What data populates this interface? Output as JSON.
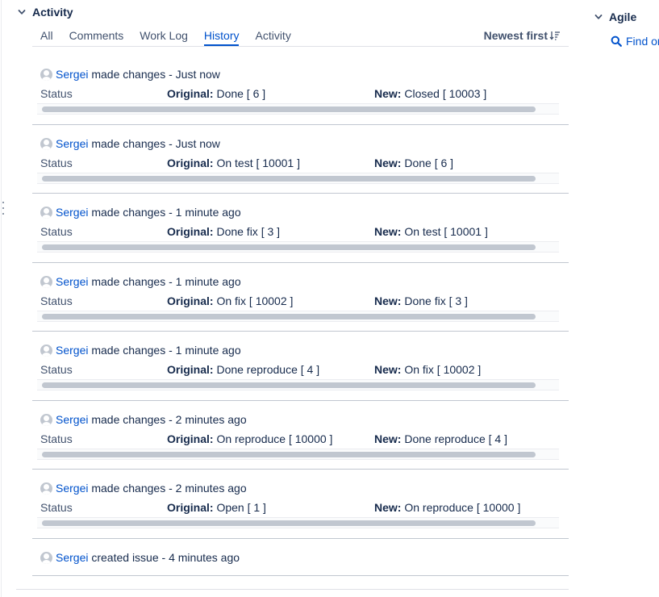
{
  "activity": {
    "title": "Activity",
    "tabs": [
      {
        "label": "All"
      },
      {
        "label": "Comments"
      },
      {
        "label": "Work Log"
      },
      {
        "label": "History"
      },
      {
        "label": "Activity"
      }
    ],
    "active_tab": "History",
    "sort_label": "Newest first",
    "original_label": "Original:",
    "new_label": "New:",
    "entries": [
      {
        "user": "Sergei",
        "action": "made changes",
        "time": "Just now",
        "field": "Status",
        "original": "Done [ 6 ]",
        "new": "Closed [ 10003 ]"
      },
      {
        "user": "Sergei",
        "action": "made changes",
        "time": "Just now",
        "field": "Status",
        "original": "On test [ 10001 ]",
        "new": "Done [ 6 ]"
      },
      {
        "user": "Sergei",
        "action": "made changes",
        "time": "1 minute ago",
        "field": "Status",
        "original": "Done fix [ 3 ]",
        "new": "On test [ 10001 ]"
      },
      {
        "user": "Sergei",
        "action": "made changes",
        "time": "1 minute ago",
        "field": "Status",
        "original": "On fix [ 10002 ]",
        "new": "Done fix [ 3 ]"
      },
      {
        "user": "Sergei",
        "action": "made changes",
        "time": "1 minute ago",
        "field": "Status",
        "original": "Done reproduce [ 4 ]",
        "new": "On fix [ 10002 ]"
      },
      {
        "user": "Sergei",
        "action": "made changes",
        "time": "2 minutes ago",
        "field": "Status",
        "original": "On reproduce [ 10000 ]",
        "new": "Done reproduce [ 4 ]"
      },
      {
        "user": "Sergei",
        "action": "made changes",
        "time": "2 minutes ago",
        "field": "Status",
        "original": "Open [ 1 ]",
        "new": "On reproduce [ 10000 ]"
      },
      {
        "user": "Sergei",
        "action": "created issue",
        "time": "4 minutes ago"
      }
    ]
  },
  "agile": {
    "title": "Agile",
    "find_link": "Find on"
  },
  "colors": {
    "link": "#0052cc",
    "text": "#172b4d",
    "muted": "#42526e",
    "separator": "#c1c7d0"
  }
}
